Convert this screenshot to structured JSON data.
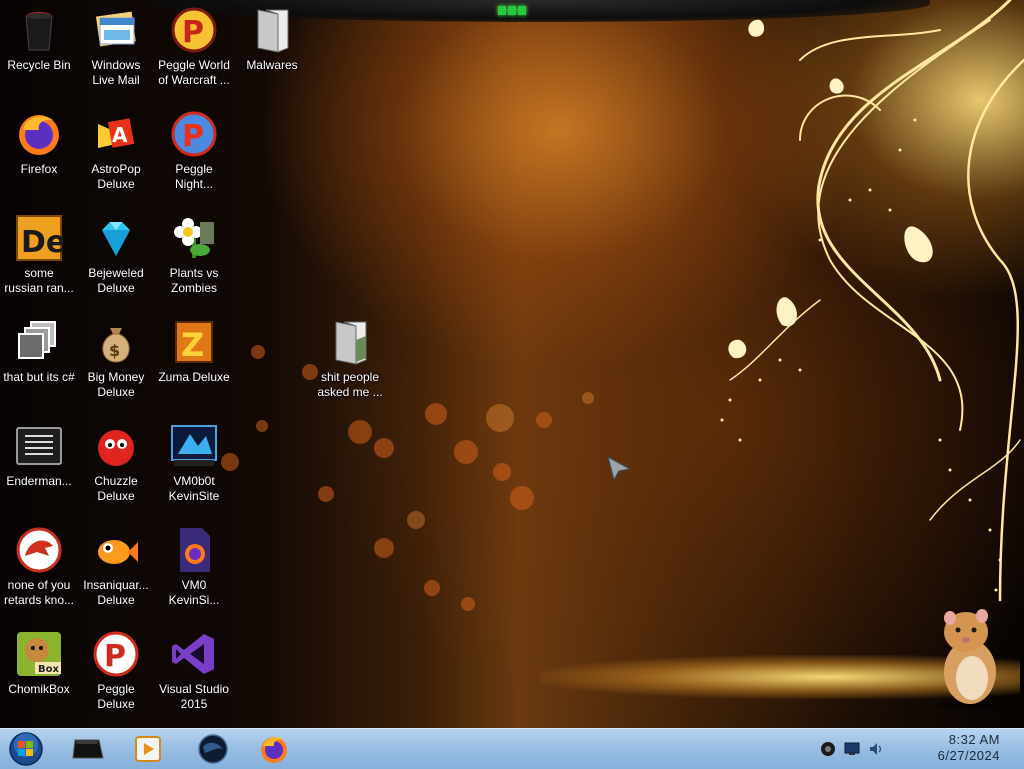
{
  "desktop": {
    "icons": [
      {
        "id": "recycle-bin",
        "label": "Recycle Bin"
      },
      {
        "id": "windows-live-mail",
        "label": "Windows\nLive Mail"
      },
      {
        "id": "peggle-world-of-warcraft",
        "label": "Peggle World\nof Warcraft ..."
      },
      {
        "id": "malwares",
        "label": "Malwares"
      },
      {
        "id": "firefox",
        "label": "Firefox"
      },
      {
        "id": "astropop-deluxe",
        "label": "AstroPop\nDeluxe"
      },
      {
        "id": "peggle-nights",
        "label": "Peggle\nNight..."
      },
      {
        "id": "some-russian",
        "label": "some\nrussian ran..."
      },
      {
        "id": "bejeweled-deluxe",
        "label": "Bejeweled\nDeluxe"
      },
      {
        "id": "plants-vs-zombies",
        "label": "Plants vs\nZombies"
      },
      {
        "id": "that-but-its-csharp",
        "label": "that but its c#"
      },
      {
        "id": "big-money-deluxe",
        "label": "Big Money\nDeluxe"
      },
      {
        "id": "zuma-deluxe",
        "label": "Zuma Deluxe"
      },
      {
        "id": "people-asked-folder",
        "label": "shit people\nasked me ..."
      },
      {
        "id": "enderman",
        "label": "Enderman..."
      },
      {
        "id": "chuzzle-deluxe",
        "label": "Chuzzle\nDeluxe"
      },
      {
        "id": "vm0b0t-kevinsite",
        "label": "VM0b0t\nKevinSite"
      },
      {
        "id": "none-of-you",
        "label": "none of you\nretards kno..."
      },
      {
        "id": "insaniquarium-deluxe",
        "label": "Insaniquar...\nDeluxe"
      },
      {
        "id": "vm0-kevinsite",
        "label": "VM0\nKevinSi..."
      },
      {
        "id": "chomikbox",
        "label": "ChomikBox"
      },
      {
        "id": "peggle-deluxe",
        "label": "Peggle\nDeluxe"
      },
      {
        "id": "visual-studio-2015",
        "label": "Visual Studio\n2015"
      }
    ]
  },
  "taskbar": {
    "pinned": [
      {
        "id": "start",
        "icon": "windows-orb-icon"
      },
      {
        "id": "computer",
        "icon": "computer-icon"
      },
      {
        "id": "media-player",
        "icon": "media-player-icon"
      },
      {
        "id": "globe",
        "icon": "globe-icon"
      },
      {
        "id": "firefox",
        "icon": "firefox-icon"
      }
    ],
    "tray": [
      "network-icon",
      "display-icon",
      "volume-icon"
    ],
    "clock": {
      "time": "8:32 AM",
      "date": "6/27/2024"
    }
  },
  "colors": {
    "taskbar": "#96bde3",
    "accent": "#e8a53a",
    "notch": "#29c73a"
  }
}
